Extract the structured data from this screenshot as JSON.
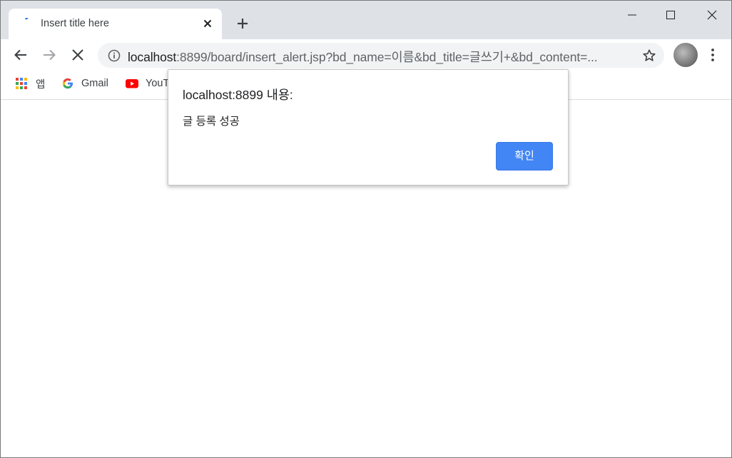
{
  "tab": {
    "title": "Insert title here"
  },
  "toolbar": {
    "url_host": "localhost",
    "url_rest": ":8899/board/insert_alert.jsp?bd_name=이름&bd_title=글쓰기+&bd_content=..."
  },
  "bookmarks": [
    {
      "label": "앱",
      "icon": "apps-grid-icon"
    },
    {
      "label": "Gmail",
      "icon": "google-g-icon"
    },
    {
      "label": "YouT",
      "icon": "youtube-icon"
    }
  ],
  "dialog": {
    "title": "localhost:8899 내용:",
    "message": "글 등록 성공",
    "ok_label": "확인"
  },
  "colors": {
    "accent": "#4285f4",
    "tabstrip": "#dee1e6",
    "omnibox": "#f1f3f4"
  }
}
